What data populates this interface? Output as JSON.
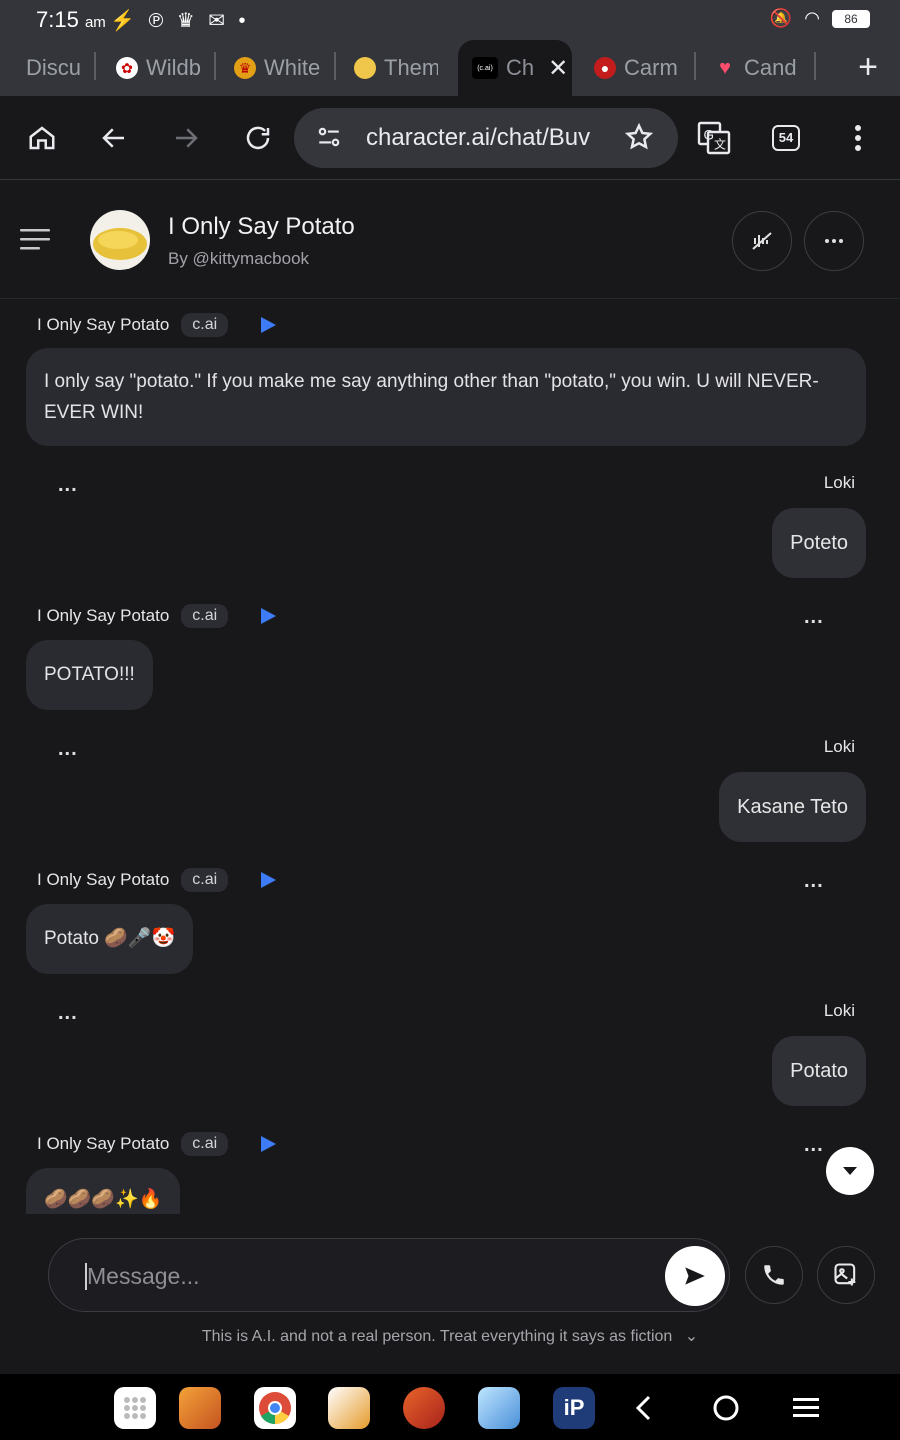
{
  "status": {
    "time": "7:15",
    "ampm": "am",
    "battery": "86"
  },
  "tabs": [
    {
      "label": "Discu"
    },
    {
      "label": "Wildb"
    },
    {
      "label": "White"
    },
    {
      "label": "Them"
    },
    {
      "label": "Ch",
      "active": true,
      "icon_text": "(c.ai)"
    },
    {
      "label": "Carm"
    },
    {
      "label": "Cand"
    }
  ],
  "toolbar": {
    "url": "character.ai/chat/Buv",
    "tab_count": "54"
  },
  "header": {
    "name": "I Only Say Potato",
    "by": "By @kittymacbook"
  },
  "messages": [
    {
      "role": "bot",
      "name": "I Only Say Potato",
      "badge": "c.ai",
      "text": "I only say \"potato.\" If you make me say anything other than \"potato,\" you win. U will NEVER-EVER WIN!"
    },
    {
      "role": "user",
      "name": "Loki",
      "text": "Poteto"
    },
    {
      "role": "bot",
      "name": "I Only Say Potato",
      "badge": "c.ai",
      "text": "POTATO!!!"
    },
    {
      "role": "user",
      "name": "Loki",
      "text": "Kasane Teto"
    },
    {
      "role": "bot",
      "name": "I Only Say Potato",
      "badge": "c.ai",
      "text": "Potato 🥔🎤🤡"
    },
    {
      "role": "user",
      "name": "Loki",
      "text": "Potato"
    },
    {
      "role": "bot",
      "name": "I Only Say Potato",
      "badge": "c.ai",
      "text": "🥔🥔🥔✨🔥"
    }
  ],
  "more_dots": "...",
  "composer": {
    "placeholder": "Message...",
    "disclaimer": "This is A.I. and not a real person. Treat everything it says as fiction"
  }
}
